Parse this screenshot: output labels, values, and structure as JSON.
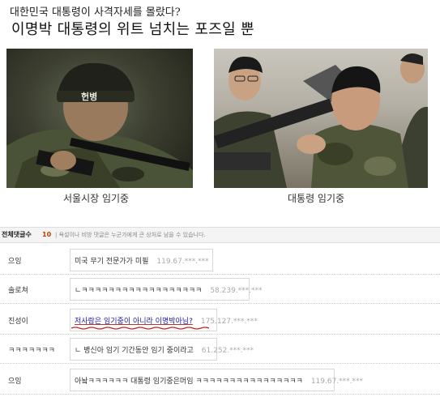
{
  "header": {
    "title_small": "대한민국 대통령이 사격자세를 몰랐다?",
    "title_large": "이명박 대통령의 위트 넘치는 포즈일 뿐"
  },
  "photos": [
    {
      "caption": "서울시장 임기중",
      "helmet_text": "헌병"
    },
    {
      "caption": "대통령 임기중"
    }
  ],
  "comments_bar": {
    "label": "전체댓글수",
    "count": "10",
    "notice": "| 욕설이나 비방 댓글은 누군가에게 큰 상처로 남을 수 있습니다."
  },
  "comments": [
    {
      "nick": "으잉",
      "text": "미국 무기 전문가가 미필",
      "ip": "119.67.***.***"
    },
    {
      "nick": "솔로쳐",
      "text": "ㄴㅋㅋㅋㅋㅋㅋㅋㅋㅋㅋㅋㅋㅋㅋㅋㅋㅋㅋ",
      "ip": "58.239.***.***"
    },
    {
      "nick": "진성이",
      "text": "저사람은 임기중이 아니라 이명박아님?",
      "ip": "175.127.***.***"
    },
    {
      "nick": "ㅋㅋㅋㅋㅋㅋㅋ",
      "text": "ㄴ 병신아 임기 기간동안 임기 중이라고",
      "ip": "61.252.***.***"
    },
    {
      "nick": "으잉",
      "text": "아놬ㅋㅋㅋㅋㅋㅋ 대통령 임기중은머임 ㅋㅋㅋㅋㅋㅋㅋㅋㅋㅋㅋㅋㅋㅋㅋㅋ",
      "ip": "119.67.***.***"
    }
  ],
  "colors": {
    "count": "#c04000",
    "highlight_text": "#1a1aa0",
    "squiggle": "#cc2222"
  }
}
